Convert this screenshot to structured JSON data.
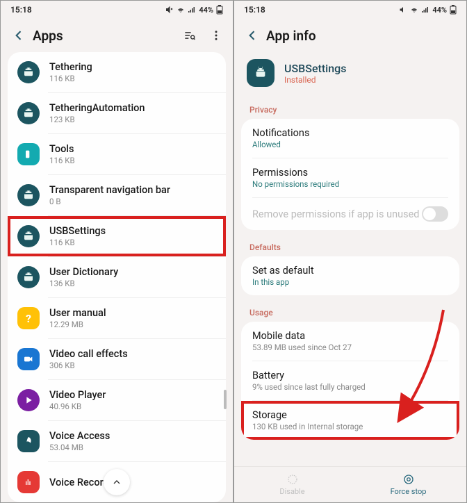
{
  "status": {
    "time": "15:18",
    "battery": "44%"
  },
  "left": {
    "title": "Apps",
    "items": [
      {
        "name": "Tethering",
        "size": "116 KB",
        "icon": "teal-round",
        "glyph": "android"
      },
      {
        "name": "TetheringAutomation",
        "size": "123 KB",
        "icon": "teal-round",
        "glyph": "android"
      },
      {
        "name": "Tools",
        "size": "116 KB",
        "icon": "teal-sq",
        "glyph": "rect"
      },
      {
        "name": "Transparent navigation bar",
        "size": "0 B",
        "icon": "teal-round",
        "glyph": "android"
      },
      {
        "name": "USBSettings",
        "size": "116 KB",
        "icon": "teal-round",
        "glyph": "android",
        "highlight": true
      },
      {
        "name": "User Dictionary",
        "size": "136 KB",
        "icon": "teal-round",
        "glyph": "android"
      },
      {
        "name": "User manual",
        "size": "12.29 MB",
        "icon": "yel-sq",
        "glyph": "q"
      },
      {
        "name": "Video call effects",
        "size": "306 KB",
        "icon": "blue-sq",
        "glyph": "cam"
      },
      {
        "name": "Video Player",
        "size": "40.96 KB",
        "icon": "purp-round",
        "glyph": "play"
      },
      {
        "name": "Voice Access",
        "size": "53.04 MB",
        "icon": "teal-leaf",
        "glyph": "leaf"
      },
      {
        "name": "Voice Recorder",
        "size": "",
        "icon": "red-sq",
        "glyph": "rec"
      }
    ]
  },
  "right": {
    "title": "App info",
    "app": {
      "name": "USBSettings",
      "status": "Installed"
    },
    "sections": {
      "privacy": {
        "label": "Privacy",
        "rows": [
          {
            "title": "Notifications",
            "sub": "Allowed",
            "subColor": "teal"
          },
          {
            "title": "Permissions",
            "sub": "No permissions required",
            "subColor": "teal"
          },
          {
            "title": "Remove permissions if app is unused",
            "toggle": true,
            "disabled": true
          }
        ]
      },
      "defaults": {
        "label": "Defaults",
        "rows": [
          {
            "title": "Set as default",
            "sub": "In this app",
            "subColor": "teal"
          }
        ]
      },
      "usage": {
        "label": "Usage",
        "rows": [
          {
            "title": "Mobile data",
            "sub": "53.89 MB used since Oct 27",
            "subColor": "gray"
          },
          {
            "title": "Battery",
            "sub": "9% used since last fully charged",
            "subColor": "gray"
          },
          {
            "title": "Storage",
            "sub": "130 KB used in Internal storage",
            "subColor": "gray",
            "highlight": true
          }
        ]
      }
    },
    "bottom": {
      "disable": "Disable",
      "force_stop": "Force stop"
    }
  }
}
